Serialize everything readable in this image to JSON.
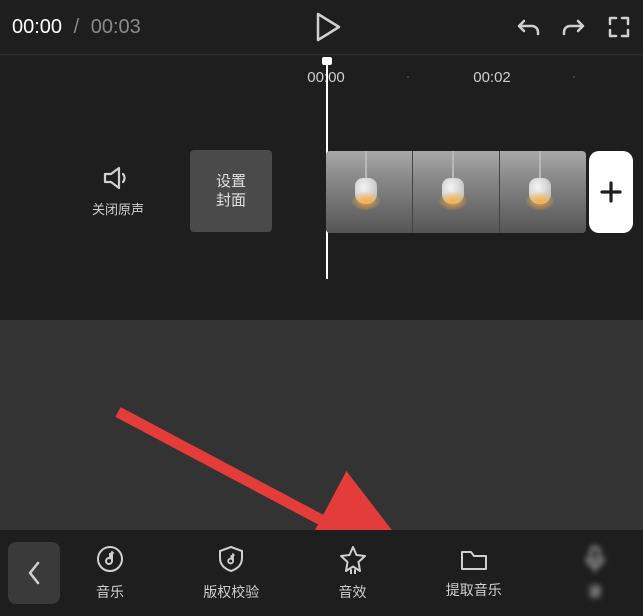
{
  "player": {
    "current": "00:00",
    "total": "00:03"
  },
  "ruler": {
    "t0": "00:00",
    "t1": "00:02"
  },
  "timeline": {
    "mute_label": "关闭原声",
    "cover_label": "设置\n封面"
  },
  "toolbar": {
    "music": "音乐",
    "copyright": "版权校验",
    "sound_fx": "音效",
    "extract": "提取音乐",
    "record": "录"
  }
}
